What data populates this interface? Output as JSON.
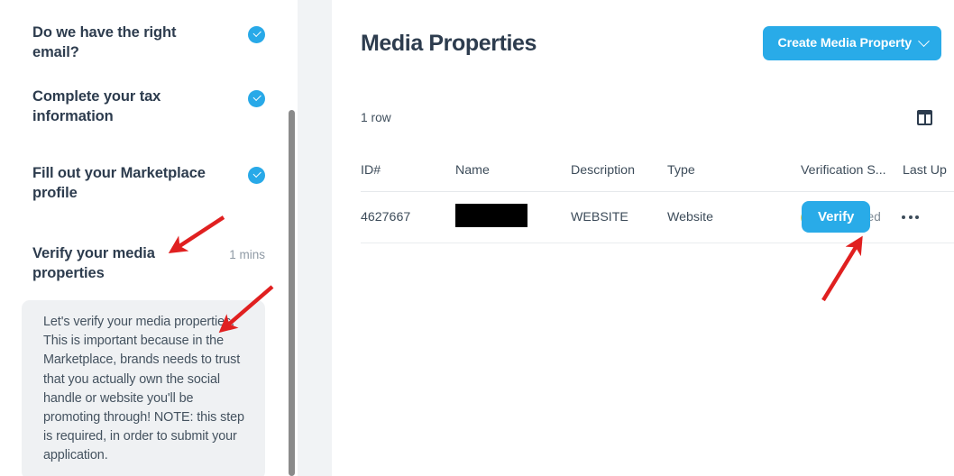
{
  "sidebar": {
    "items": [
      {
        "label": "Do we have the right email?",
        "completed": true,
        "duration": ""
      },
      {
        "label": "Complete your tax information",
        "completed": true,
        "duration": ""
      },
      {
        "label": "Fill out your Marketplace profile",
        "completed": true,
        "duration": ""
      },
      {
        "label": "Verify your media properties",
        "completed": false,
        "duration": "1 mins"
      }
    ],
    "tooltip": {
      "text": "Let's verify your media properties. This is important because in the Marketplace, brands needs to trust that you actually own the social handle or website you'll be promoting through! NOTE: this step is required, in order to submit your application."
    }
  },
  "main": {
    "title": "Media Properties",
    "create_button": "Create Media Property",
    "create_button_icon": "chevron-down-icon",
    "row_count": "1 row",
    "column_toggle_icon": "columns-layout-icon",
    "table": {
      "headers": [
        "ID#",
        "Name",
        "Description",
        "Type",
        "Verification S...",
        "Last Up"
      ],
      "rows": [
        {
          "id": "4627667",
          "name": "",
          "description": "WEBSITE",
          "type": "Website",
          "verification_status": "Not verified",
          "verification_icon": "pending-circle-icon",
          "action_label": "Verify",
          "overflow_icon": "more-options-icon"
        }
      ]
    }
  },
  "annotations": {
    "arrow_color": "#e02020",
    "arrows": [
      {
        "name": "arrow-to-verify-media-step"
      },
      {
        "name": "arrow-to-tooltip"
      },
      {
        "name": "arrow-to-verify-button"
      }
    ]
  },
  "colors": {
    "accent": "#29abe8",
    "text": "#2d3c4e",
    "muted": "#8f9aa5",
    "tooltip_bg": "#eff1f3",
    "pending": "#efd24e",
    "annotation": "#e02020"
  }
}
